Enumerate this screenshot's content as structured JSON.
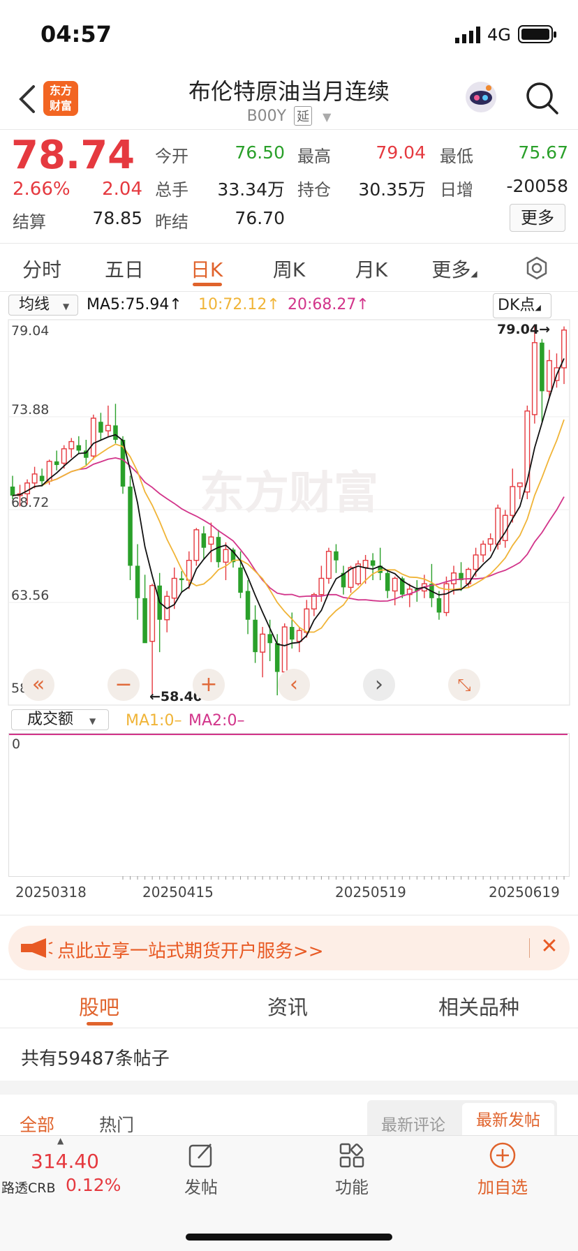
{
  "status": {
    "time": "04:57",
    "network": "4G"
  },
  "header": {
    "title": "布伦特原油当月连续",
    "code": "B00Y",
    "tag": "延",
    "logo_line1": "东方",
    "logo_line2": "财富"
  },
  "quote": {
    "price": "78.74",
    "change_pct": "2.66%",
    "change": "2.04",
    "settle_label": "结算",
    "settle": "78.85",
    "open_label": "今开",
    "open": "76.50",
    "high_label": "最高",
    "high": "79.04",
    "low_label": "最低",
    "low": "75.67",
    "volume_label": "总手",
    "volume": "33.34万",
    "oi_label": "持仓",
    "oi": "30.35万",
    "day_inc_label": "日增",
    "day_inc": "-20058",
    "prev_settle_label": "昨结",
    "prev_settle": "76.70",
    "more": "更多"
  },
  "tabs": [
    "分时",
    "五日",
    "日K",
    "周K",
    "月K",
    "更多"
  ],
  "indicators": {
    "selector": "均线",
    "ma5": "MA5:75.94↑",
    "ma10": "10:72.12↑",
    "ma20": "20:68.27↑",
    "dk": "DK点",
    "vol_selector": "成交额",
    "vol_ma1": "MA1:0–",
    "vol_ma2": "MA2:0–",
    "vol_zero": "0",
    "colors": {
      "up": "#e5393f",
      "down": "#2aa02a",
      "ma5": "#111111",
      "ma10": "#f0b437",
      "ma20": "#d2348a"
    }
  },
  "chart_data": {
    "type": "candlestick",
    "y_ticks": [
      "79.04",
      "73.88",
      "68.72",
      "63.56",
      "58.40"
    ],
    "ylim": [
      58.4,
      79.04
    ],
    "max_label": "79.04→",
    "min_label": "←58.40",
    "x_labels": [
      "20250318",
      "20250415",
      "20250519",
      "20250619"
    ],
    "candles": [
      [
        70.0,
        70.6,
        69.3,
        69.5
      ],
      [
        69.5,
        70.1,
        68.9,
        69.6
      ],
      [
        69.6,
        70.4,
        69.0,
        70.2
      ],
      [
        70.2,
        71.1,
        69.9,
        70.7
      ],
      [
        70.6,
        71.0,
        70.0,
        70.3
      ],
      [
        70.3,
        71.5,
        70.1,
        71.4
      ],
      [
        71.4,
        72.0,
        70.9,
        71.2
      ],
      [
        71.3,
        72.3,
        71.0,
        72.1
      ],
      [
        72.1,
        72.7,
        71.6,
        72.5
      ],
      [
        72.3,
        72.8,
        71.8,
        72.0
      ],
      [
        72.0,
        72.6,
        71.2,
        71.6
      ],
      [
        71.7,
        74.0,
        71.5,
        73.8
      ],
      [
        73.6,
        74.1,
        72.6,
        73.0
      ],
      [
        73.1,
        74.5,
        72.8,
        73.4
      ],
      [
        73.4,
        74.6,
        72.4,
        72.6
      ],
      [
        72.6,
        72.8,
        69.6,
        70.0
      ],
      [
        70.0,
        70.6,
        64.8,
        65.6
      ],
      [
        65.6,
        66.8,
        62.6,
        63.8
      ],
      [
        63.8,
        65.1,
        61.8,
        61.3
      ],
      [
        61.4,
        64.6,
        58.4,
        64.5
      ],
      [
        64.5,
        65.2,
        60.8,
        62.6
      ],
      [
        62.6,
        64.2,
        61.9,
        63.9
      ],
      [
        63.8,
        65.5,
        63.2,
        64.9
      ],
      [
        64.9,
        65.3,
        64.1,
        64.8
      ],
      [
        64.8,
        66.4,
        64.3,
        65.9
      ],
      [
        65.9,
        67.7,
        65.6,
        67.6
      ],
      [
        67.4,
        67.8,
        66.0,
        66.6
      ],
      [
        66.8,
        68.0,
        65.8,
        67.2
      ],
      [
        67.2,
        67.6,
        65.5,
        65.8
      ],
      [
        65.8,
        66.9,
        64.8,
        66.5
      ],
      [
        66.5,
        66.6,
        65.5,
        65.8
      ],
      [
        65.5,
        66.4,
        63.8,
        64.1
      ],
      [
        64.2,
        64.8,
        61.8,
        62.6
      ],
      [
        62.6,
        63.4,
        60.2,
        60.8
      ],
      [
        60.8,
        62.2,
        59.4,
        61.8
      ],
      [
        61.8,
        62.6,
        60.3,
        61.3
      ],
      [
        61.3,
        61.8,
        58.4,
        59.7
      ],
      [
        59.7,
        62.4,
        59.6,
        62.2
      ],
      [
        62.2,
        63.0,
        61.0,
        61.5
      ],
      [
        61.4,
        62.2,
        60.8,
        62.0
      ],
      [
        61.9,
        63.7,
        61.6,
        63.2
      ],
      [
        63.2,
        64.1,
        62.8,
        64.0
      ],
      [
        64.0,
        65.6,
        63.6,
        64.9
      ],
      [
        64.9,
        66.6,
        64.6,
        66.4
      ],
      [
        66.4,
        66.8,
        65.2,
        65.9
      ],
      [
        65.2,
        65.6,
        64.0,
        64.4
      ],
      [
        64.4,
        65.6,
        64.1,
        65.5
      ],
      [
        64.6,
        65.9,
        64.5,
        65.7
      ],
      [
        65.5,
        66.2,
        64.6,
        65.9
      ],
      [
        65.9,
        66.3,
        64.8,
        65.6
      ],
      [
        65.6,
        66.6,
        64.8,
        65.2
      ],
      [
        65.2,
        65.4,
        63.8,
        64.2
      ],
      [
        64.2,
        65.0,
        63.4,
        64.9
      ],
      [
        64.9,
        65.0,
        63.8,
        64.0
      ],
      [
        64.0,
        64.6,
        63.3,
        64.3
      ],
      [
        64.3,
        64.8,
        63.6,
        64.2
      ],
      [
        64.2,
        65.1,
        63.8,
        64.6
      ],
      [
        64.6,
        65.7,
        63.3,
        63.8
      ],
      [
        63.8,
        64.2,
        62.6,
        63.0
      ],
      [
        63.0,
        65.0,
        62.8,
        64.6
      ],
      [
        64.6,
        65.6,
        64.0,
        65.2
      ],
      [
        65.2,
        65.8,
        64.2,
        64.8
      ],
      [
        64.6,
        65.5,
        64.4,
        65.4
      ],
      [
        65.4,
        66.6,
        65.0,
        66.2
      ],
      [
        66.2,
        67.0,
        65.8,
        66.8
      ],
      [
        66.8,
        67.4,
        66.4,
        67.1
      ],
      [
        66.8,
        69.0,
        66.5,
        68.8
      ],
      [
        67.0,
        68.7,
        66.6,
        68.4
      ],
      [
        68.4,
        71.0,
        68.0,
        70.0
      ],
      [
        70.0,
        70.2,
        69.3,
        70.2
      ],
      [
        69.7,
        74.5,
        69.3,
        74.2
      ],
      [
        74.0,
        79.0,
        73.5,
        78.0
      ],
      [
        78.0,
        78.2,
        73.6,
        75.3
      ],
      [
        75.3,
        77.6,
        75.0,
        77.0
      ],
      [
        75.9,
        77.4,
        75.5,
        76.6
      ],
      [
        76.6,
        78.9,
        75.7,
        78.7
      ]
    ]
  },
  "banner": {
    "text": "点此立享一站式期货开户服务>>"
  },
  "content_tabs": [
    "股吧",
    "资讯",
    "相关品种"
  ],
  "posts": {
    "count_text": "共有59487条帖子",
    "filter_all": "全部",
    "filter_hot": "热门",
    "sort_comment": "最新评论",
    "sort_post": "最新发帖"
  },
  "footer": {
    "index_value": "314.40",
    "index_name": "路透CRB",
    "index_change": "0.12%",
    "post": "发帖",
    "func": "功能",
    "watch": "加自选"
  }
}
